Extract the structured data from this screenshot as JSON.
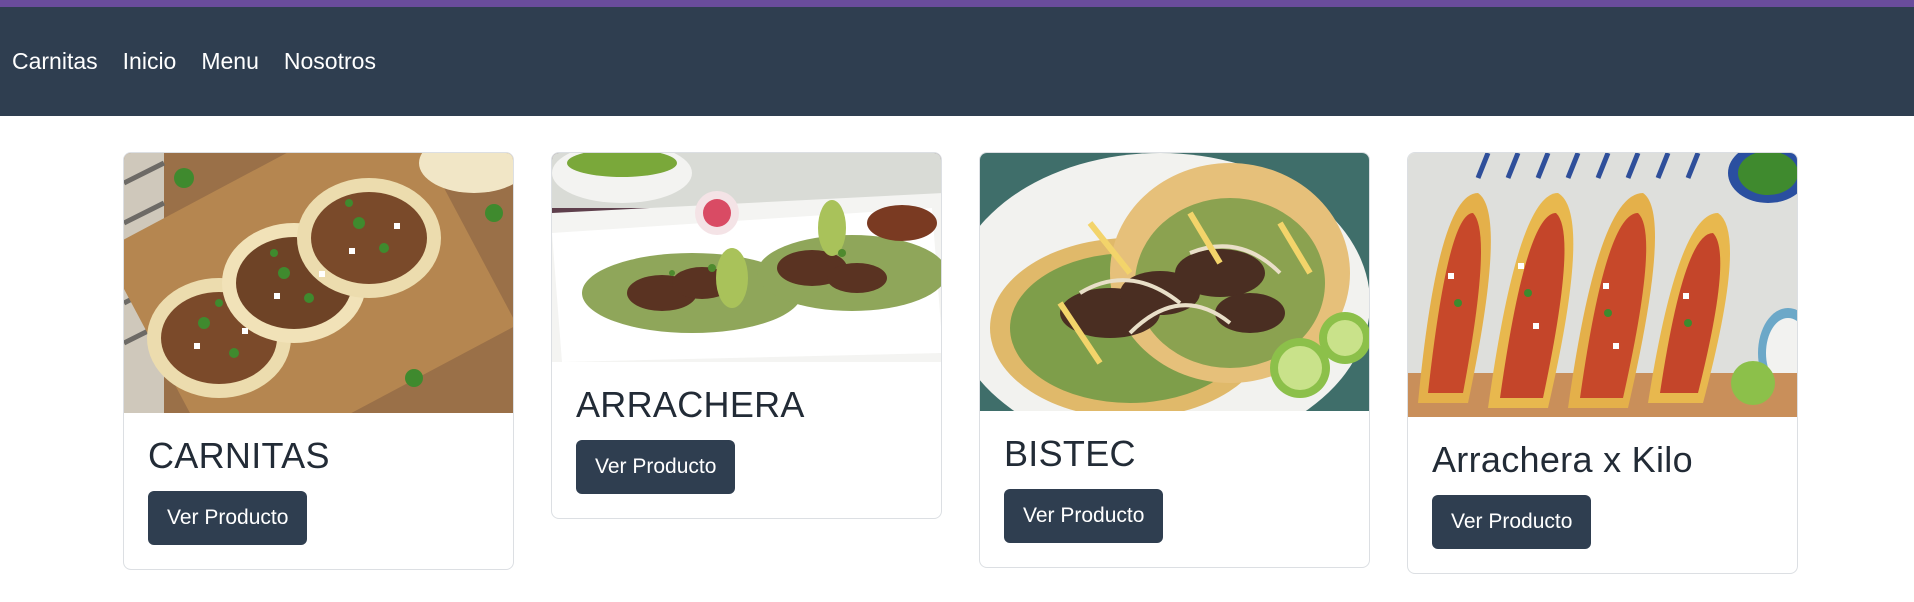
{
  "colors": {
    "accent_strip": "#6a4c9c",
    "navbar_bg": "#2f3e50",
    "button_bg": "#2f3e50"
  },
  "nav": {
    "items": [
      "Carnitas",
      "Inicio",
      "Menu",
      "Nosotros"
    ]
  },
  "products": [
    {
      "title": "CARNITAS",
      "button": "Ver Producto",
      "image": "carnitas-tacos-photo"
    },
    {
      "title": "ARRACHERA",
      "button": "Ver Producto",
      "image": "arrachera-tacos-photo"
    },
    {
      "title": "BISTEC",
      "button": "Ver Producto",
      "image": "bistec-tacos-photo"
    },
    {
      "title": "Arrachera x Kilo",
      "button": "Ver Producto",
      "image": "al-pastor-tacos-photo"
    }
  ]
}
